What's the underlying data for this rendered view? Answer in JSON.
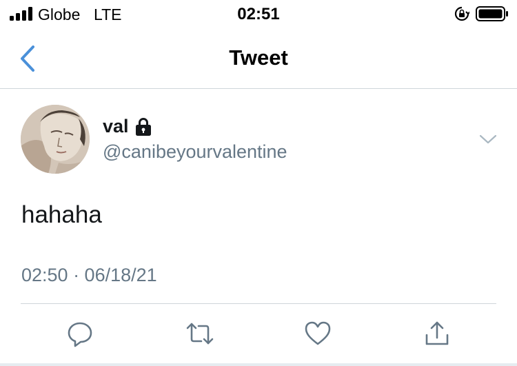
{
  "status_bar": {
    "carrier": "Globe",
    "network": "LTE",
    "time": "02:51"
  },
  "nav": {
    "title": "Tweet",
    "accent": "#4a90d9"
  },
  "tweet": {
    "display_name": "val",
    "protected": true,
    "handle": "@canibeyourvalentine",
    "text": "hahaha",
    "timestamp": "02:50 · 06/18/21"
  },
  "actions": [
    "reply-icon",
    "retweet-icon",
    "like-icon",
    "share-icon"
  ],
  "colors": {
    "text_primary": "#14171a",
    "text_secondary": "#657786",
    "icon": "#657786",
    "divider": "#cfd5da"
  }
}
